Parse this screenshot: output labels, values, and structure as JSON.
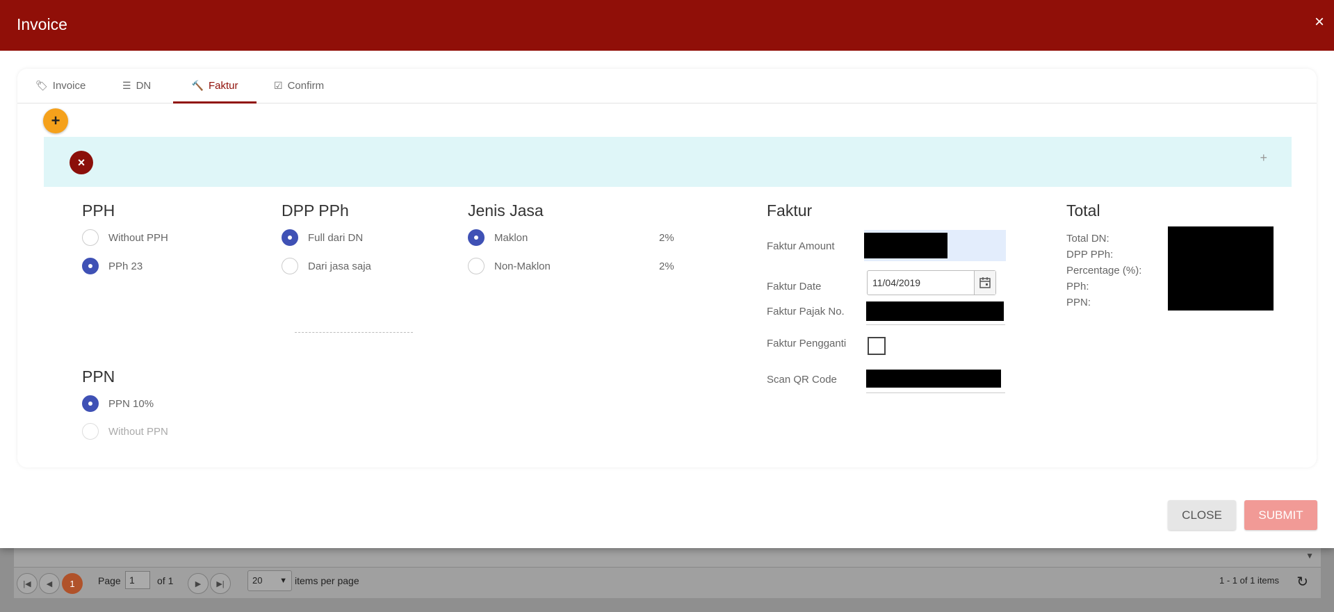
{
  "modal": {
    "title": "Invoice",
    "close_symbol": "×"
  },
  "tabs": [
    {
      "label": "Invoice",
      "icon": "tag-icon",
      "glyph": "🏷"
    },
    {
      "label": "DN",
      "icon": "list-icon",
      "glyph": "☰"
    },
    {
      "label": "Faktur",
      "icon": "gavel-icon",
      "glyph": "🔨",
      "active": true
    },
    {
      "label": "Confirm",
      "icon": "check-square-icon",
      "glyph": "☑"
    }
  ],
  "add_symbol": "+",
  "strip": {
    "remove_symbol": "×",
    "expand_symbol": "+"
  },
  "pph": {
    "title": "PPH",
    "options": [
      {
        "label": "Without PPH",
        "selected": false
      },
      {
        "label": "PPh 23",
        "selected": true
      }
    ]
  },
  "dpp_pph": {
    "title": "DPP PPh",
    "options": [
      {
        "label": "Full dari DN",
        "selected": true
      },
      {
        "label": "Dari jasa saja",
        "selected": false
      }
    ]
  },
  "jenis_jasa": {
    "title": "Jenis Jasa",
    "options": [
      {
        "label": "Maklon",
        "selected": true,
        "pct": "2%"
      },
      {
        "label": "Non-Maklon",
        "selected": false,
        "pct": "2%"
      }
    ]
  },
  "ppn": {
    "title": "PPN",
    "options": [
      {
        "label": "PPN 10%",
        "selected": true
      },
      {
        "label": "Without PPN",
        "selected": false
      }
    ]
  },
  "faktur": {
    "title": "Faktur",
    "amount_label": "Faktur Amount",
    "date_label": "Faktur Date",
    "date_value": "11/04/2019",
    "pajak_no_label": "Faktur Pajak No.",
    "pengganti_label": "Faktur Pengganti",
    "pengganti_checked": false,
    "qr_label": "Scan QR Code"
  },
  "total": {
    "title": "Total",
    "labels": [
      "Total DN:",
      "DPP PPh:",
      "Percentage (%):",
      "PPh:",
      "PPN:"
    ]
  },
  "footer": {
    "close_label": "CLOSE",
    "submit_label": "SUBMIT"
  },
  "pager": {
    "current_page": "1",
    "page_label": "Page",
    "page_value": "1",
    "of_label": "of 1",
    "page_size": "20",
    "items_per_page_label": "items per page",
    "info": "1 - 1 of 1 items"
  },
  "colors": {
    "header": "#900f08",
    "accent": "#900f08",
    "radio_selected": "#3f51b5",
    "add_button": "#f5a11b",
    "strip": "#dff6f8",
    "submit": "#f19a96"
  }
}
